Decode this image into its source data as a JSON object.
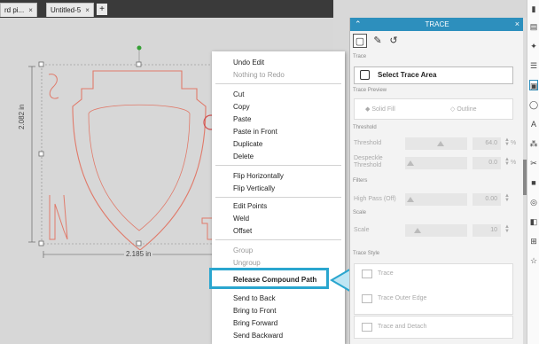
{
  "tabs": [
    {
      "label": "rd pi...",
      "close": "×"
    },
    {
      "label": "Untitled-5",
      "close": "×"
    }
  ],
  "tab_add": "+",
  "dimensions": {
    "height": "2.082 in",
    "width": "2.185 in"
  },
  "context_menu": {
    "items": [
      {
        "label": "Undo Edit",
        "disabled": false
      },
      {
        "label": "Nothing to Redo",
        "disabled": true
      },
      {
        "label": "Cut",
        "disabled": false
      },
      {
        "label": "Copy",
        "disabled": false
      },
      {
        "label": "Paste",
        "disabled": false
      },
      {
        "label": "Paste in Front",
        "disabled": false
      },
      {
        "label": "Duplicate",
        "disabled": false
      },
      {
        "label": "Delete",
        "disabled": false
      },
      {
        "label": "Flip Horizontally",
        "disabled": false
      },
      {
        "label": "Flip Vertically",
        "disabled": false
      },
      {
        "label": "Edit Points",
        "disabled": false
      },
      {
        "label": "Weld",
        "disabled": false
      },
      {
        "label": "Offset",
        "disabled": false
      },
      {
        "label": "Group",
        "disabled": true
      },
      {
        "label": "Ungroup",
        "disabled": true
      },
      {
        "label": "Release Compound Path",
        "disabled": false
      },
      {
        "label": "Send to Back",
        "disabled": false
      },
      {
        "label": "Bring to Front",
        "disabled": false
      },
      {
        "label": "Bring Forward",
        "disabled": false
      },
      {
        "label": "Send Backward",
        "disabled": false
      }
    ]
  },
  "trace_panel": {
    "title": "TRACE",
    "section_trace": "Trace",
    "select_trace_area": "Select Trace Area",
    "section_preview": "Trace Preview",
    "solid_fill": "Solid Fill",
    "outline": "Outline",
    "section_threshold": "Threshold",
    "threshold_label": "Threshold",
    "threshold_value": "64.0",
    "despeckle_label": "Despeckle Threshold",
    "despeckle_value": "0.0",
    "section_filters": "Filters",
    "highpass_label": "High Pass (Off)",
    "highpass_value": "0.00",
    "section_scale": "Scale",
    "scale_label": "Scale",
    "scale_value": "10",
    "section_style": "Trace Style",
    "style_trace": "Trace",
    "style_outer_edge": "Trace Outer Edge",
    "style_detach": "Trace and Detach",
    "percent": "%"
  },
  "colors": {
    "accent": "#2aa6cf",
    "panel_header": "#2d8fbd",
    "shape_stroke": "#e07a6a"
  }
}
